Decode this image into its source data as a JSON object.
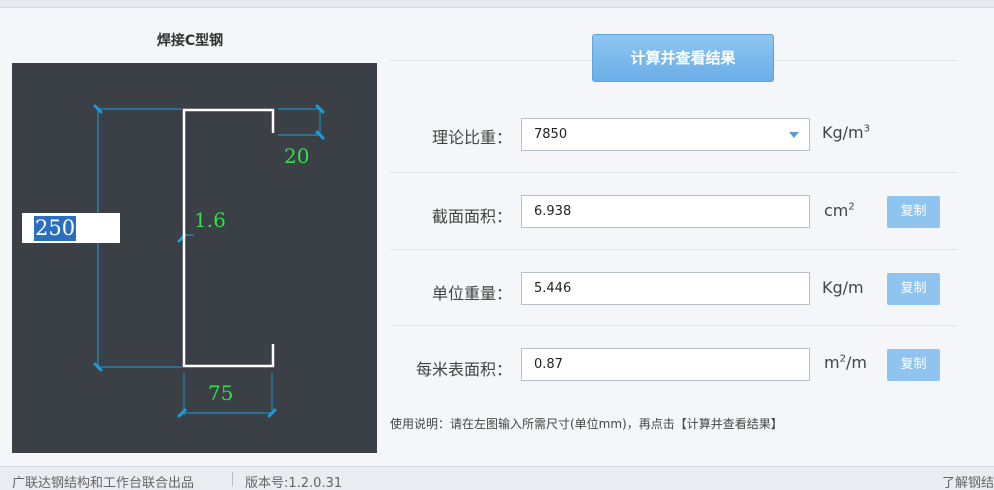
{
  "left_panel": {
    "title": "焊接C型钢",
    "dims": {
      "height": "250",
      "thickness": "1.6",
      "lip": "20",
      "width": "75"
    }
  },
  "calc_button_label": "计算并查看结果",
  "rows": {
    "density": {
      "label": "理论比重：",
      "value": "7850",
      "unit": "Kg/m",
      "unit_sup": "3"
    },
    "area": {
      "label": "截面面积：",
      "value": "6.938",
      "unit": "cm",
      "unit_sup": "2",
      "copy_label": "复制"
    },
    "weight": {
      "label": "单位重量：",
      "value": "5.446",
      "unit": "Kg/m",
      "copy_label": "复制"
    },
    "surface": {
      "label": "每米表面积：",
      "value": "0.87",
      "unit_pre": "m",
      "unit_sup": "2",
      "unit_post": "/m",
      "copy_label": "复制"
    }
  },
  "help_text": "使用说明：请在左图输入所需尺寸(单位mm)，再点击【计算并查看结果】",
  "footer": {
    "left": "广联达钢结构和工作台联合出品",
    "version": "版本号:1.2.0.31",
    "right": "了解钢结"
  },
  "colors": {
    "canvas_bg": "#3b4047",
    "dim_text": "#30e046",
    "dim_line": "#1e9bd7",
    "button": "#6aaee7"
  }
}
